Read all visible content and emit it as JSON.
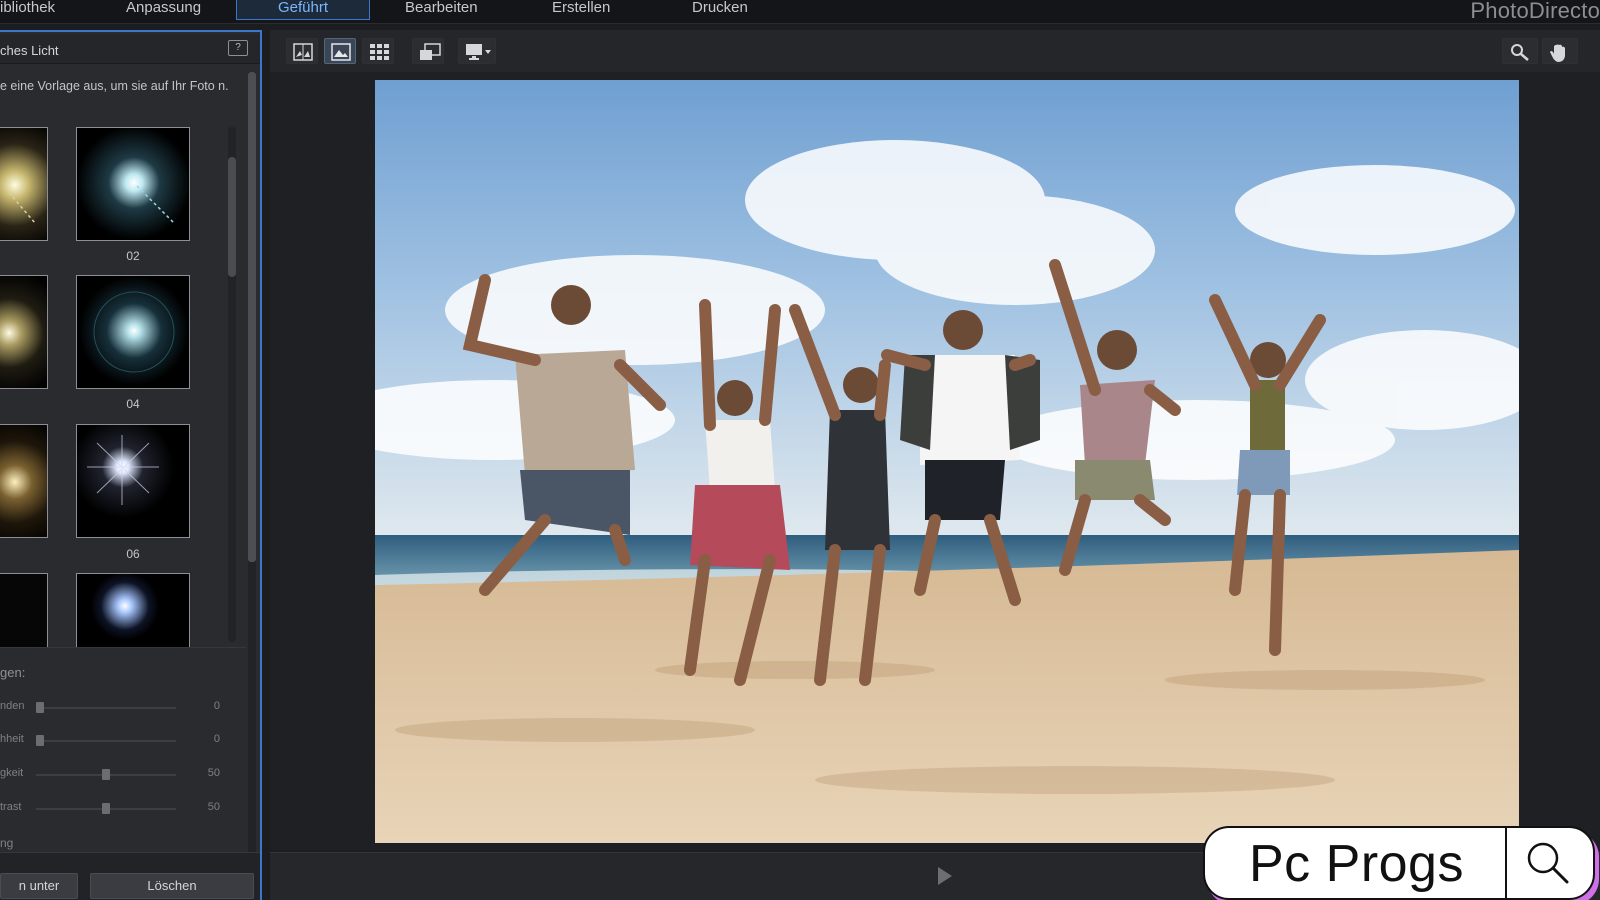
{
  "menubar": {
    "items": [
      "ibliothek",
      "Anpassung",
      "Geführt",
      "Bearbeiten",
      "Erstellen",
      "Drucken"
    ],
    "active_index": 2,
    "brand": "PhotoDirecto"
  },
  "leftpanel": {
    "title": "ches Licht",
    "help_icon": "?",
    "instructions": "e eine Vorlage aus, um sie auf Ihr Foto n.",
    "thumbnails": [
      {
        "label": "",
        "icon": "light-flare-icon"
      },
      {
        "label": "02",
        "icon": "light-flare-icon"
      },
      {
        "label": "",
        "icon": "light-flare-icon"
      },
      {
        "label": "04",
        "icon": "light-flare-icon"
      },
      {
        "label": "",
        "icon": "light-flare-icon"
      },
      {
        "label": "06",
        "icon": "light-flare-icon"
      },
      {
        "label": "",
        "icon": "light-flare-icon"
      },
      {
        "label": "",
        "icon": "light-flare-icon"
      }
    ],
    "adjust_heading": "gen:",
    "sliders": [
      {
        "label": "nden",
        "value": "0",
        "level": 0
      },
      {
        "label": "hheit",
        "value": "0",
        "level": 0
      },
      {
        "label": "gkeit",
        "value": "50",
        "level": 0.5
      },
      {
        "label": "trast",
        "value": "50",
        "level": 0.5
      }
    ],
    "adjust_footer": "ng",
    "buttons": {
      "save_as": "n unter",
      "delete": "Löschen"
    }
  },
  "toolbar": {
    "icons": [
      "compare-view-icon",
      "single-view-icon",
      "grid-view-icon",
      "resize-window-icon",
      "monitor-menu-icon"
    ],
    "right_icons": [
      "zoom-icon",
      "hand-pan-icon"
    ]
  },
  "playbar": {
    "icon": "play-icon"
  },
  "overlay": {
    "text": "Pc Progs",
    "icon": "search-icon"
  },
  "colors": {
    "accent": "#3b78c9",
    "panel": "#2a2b2f",
    "bg": "#1c1d20"
  }
}
